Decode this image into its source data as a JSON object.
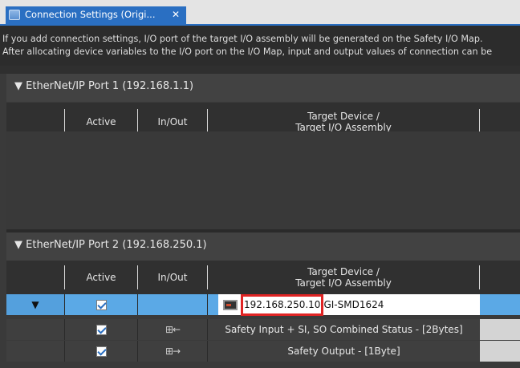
{
  "tab": {
    "title": "Connection Settings (Origi...",
    "close": "✕"
  },
  "message": {
    "line1": "If you add connection settings, I/O port of the target I/O assembly will be generated on the Safety I/O Map.",
    "line2": "After allocating device variables to the I/O port on the I/O Map, input and output values of connection can be"
  },
  "columns": {
    "active": "Active",
    "inout": "In/Out",
    "target_line1": "Target Device /",
    "target_line2": "Target I/O Assembly"
  },
  "port1": {
    "header": "▼ EtherNet/IP Port 1 (192.168.1.1)"
  },
  "port2": {
    "header": "▼ EtherNet/IP Port 2 (192.168.250.1)",
    "rows": [
      {
        "expander": "▼",
        "active": true,
        "inout": "",
        "target_ip": "192.168.250.10",
        "target_name": "GI-SMD1624"
      },
      {
        "active": true,
        "inout_icon": "input-arrow-icon",
        "inout_glyph": "⊞←",
        "target": "Safety Input + SI, SO Combined Status - [2Bytes]"
      },
      {
        "active": true,
        "inout_icon": "output-arrow-icon",
        "inout_glyph": "⊞→",
        "target": "Safety Output - [1Byte]"
      }
    ]
  },
  "colors": {
    "accent": "#2a6fc2",
    "selected_row": "#5ba9e6",
    "highlight_box": "#e02424"
  }
}
